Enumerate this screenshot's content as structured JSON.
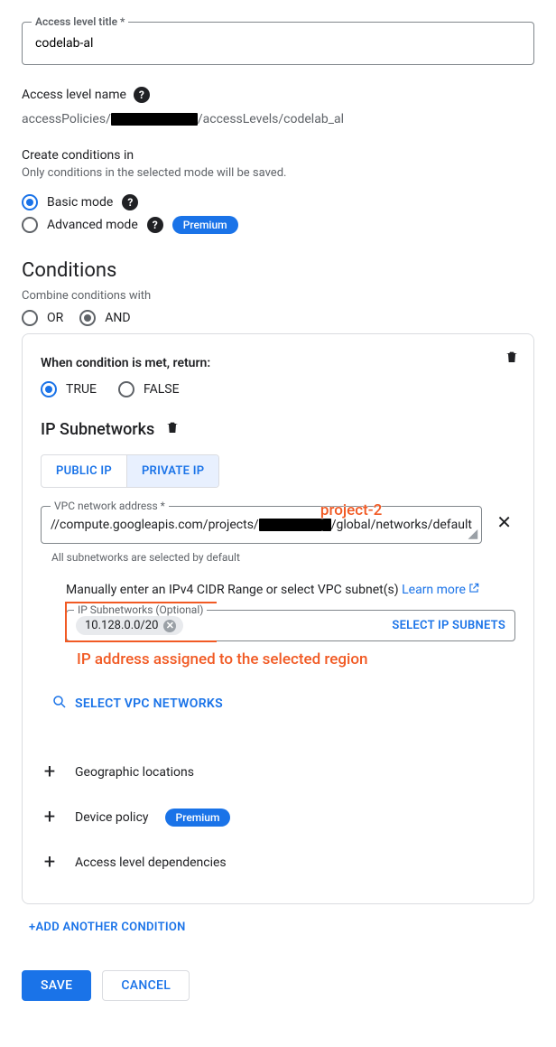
{
  "title_field": {
    "label": "Access level title *",
    "value": "codelab-al"
  },
  "name_label": "Access level name",
  "path": {
    "prefix": "accessPolicies/",
    "mid": "/accessLevels/",
    "suffix": "codelab_al"
  },
  "create_in": {
    "label": "Create conditions in",
    "hint": "Only conditions in the selected mode will be saved.",
    "basic": "Basic mode",
    "advanced": "Advanced mode",
    "premium": "Premium"
  },
  "conditions_header": "Conditions",
  "combine": {
    "label": "Combine conditions with",
    "or": "OR",
    "and": "AND"
  },
  "card": {
    "when_return": "When condition is met, return:",
    "true": "TRUE",
    "false": "FALSE",
    "ip_title": "IP Subnetworks",
    "tabs": {
      "public": "PUBLIC IP",
      "private": "PRIVATE IP"
    },
    "vpc_label": "VPC network address *",
    "vpc_value": "//compute.googleapis.com/projects/██████████/global/networks/default",
    "vpc_hint": "All subnetworks are selected by default",
    "manual_line_prefix": "Manually enter an IPv4 CIDR Range or select VPC subnet(s) ",
    "learn_more": "Learn more",
    "subnet_label": "IP Subnetworks (Optional)",
    "subnet_chip": "10.128.0.0/20",
    "select_subnets": "SELECT IP SUBNETS",
    "select_vpc": "SELECT VPC NETWORKS",
    "addrows": {
      "geo": "Geographic locations",
      "device": "Device policy",
      "deps": "Access level dependencies"
    }
  },
  "annotations": {
    "project": "project-2",
    "ip_note": "IP address assigned to the selected region"
  },
  "add_condition": "+ADD ANOTHER CONDITION",
  "buttons": {
    "save": "SAVE",
    "cancel": "CANCEL"
  }
}
